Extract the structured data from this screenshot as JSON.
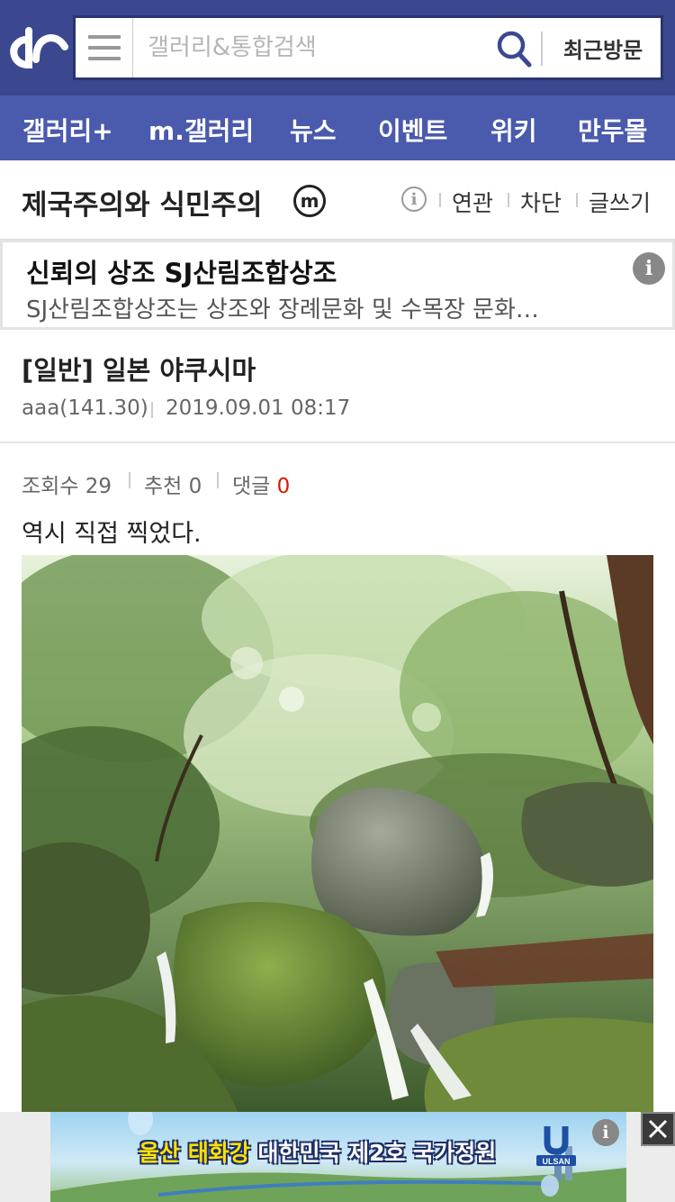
{
  "header": {
    "search_placeholder": "갤러리&통합검색",
    "recent_label": "최근방문"
  },
  "nav": {
    "items": [
      {
        "label": "갤러리+"
      },
      {
        "label": "m.갤러리"
      },
      {
        "label": "뉴스"
      },
      {
        "label": "이벤트"
      },
      {
        "label": "위키"
      },
      {
        "label": "만두몰"
      }
    ]
  },
  "gallery": {
    "title": "제국주의와 식민주의",
    "badge": "m",
    "info_icon_text": "i",
    "links": [
      "연관",
      "차단",
      "글쓰기"
    ]
  },
  "ad": {
    "title": "신뢰의 상조 SJ산림조합상조",
    "description": "SJ산림조합상조는 상조와 장례문화 및 수목장 문화…",
    "info_text": "i"
  },
  "post": {
    "title": "[일반] 일본 야쿠시마",
    "author": "aaa(141.30)",
    "date": "2019.09.01 08:17",
    "stats": {
      "views_label": "조회수 29",
      "recommend_label": "추천 0",
      "comment_label": "댓글",
      "comment_count": "0"
    },
    "body": "역시 직접 찍었다."
  },
  "bottom_ad": {
    "headline_part1": "울산 태화강",
    "headline_part2": "대한민국 제2호 국가정원",
    "brand": "ULSAN",
    "info_text": "i"
  },
  "colors": {
    "header_bg": "#3b4890",
    "nav_bg": "#4a5aad",
    "comment_count": "#d31900"
  }
}
